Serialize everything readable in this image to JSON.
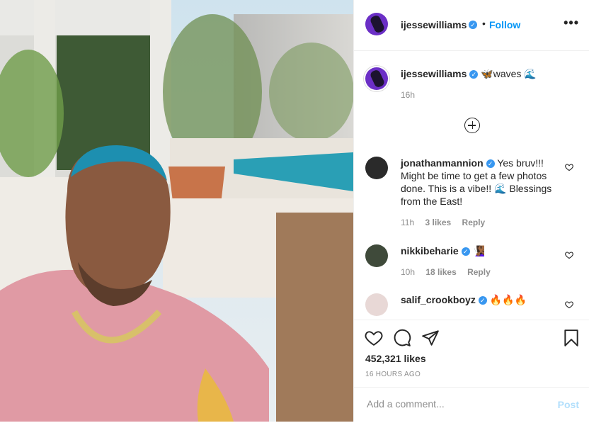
{
  "post": {
    "username": "ijessewilliams",
    "follow_label": "Follow",
    "separator": "•",
    "more_label": "•••"
  },
  "caption": {
    "username": "ijessewilliams",
    "text": "🦋waves 🌊",
    "time": "16h"
  },
  "comments": [
    {
      "username": "jonathanmannion",
      "text": "Yes bruv!!! Might be time to get a few photos done. This is a vibe!! 🌊 Blessings from the East!",
      "time": "11h",
      "likes": "3 likes",
      "reply": "Reply"
    },
    {
      "username": "nikkibeharie",
      "text": "🧏🏾‍♀️",
      "time": "10h",
      "likes": "18 likes",
      "reply": "Reply"
    },
    {
      "username": "salif_crookboyz",
      "text": "🔥🔥🔥"
    }
  ],
  "footer": {
    "likes": "452,321 likes",
    "time_ago": "16 HOURS AGO",
    "comment_placeholder": "Add a comment...",
    "post_label": "Post"
  },
  "colors": {
    "accent": "#0095f6",
    "verified": "#3897f0",
    "muted": "#8e8e8e"
  }
}
